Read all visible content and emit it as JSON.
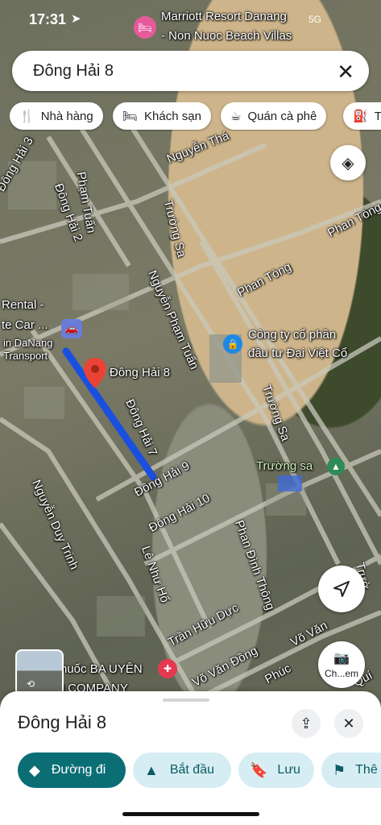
{
  "status_bar": {
    "time": "17:31",
    "network": "5G",
    "location_arrow": "location-arrow-icon"
  },
  "search": {
    "query": "Đông Hải 8",
    "clear_icon": "close-icon"
  },
  "chips": [
    {
      "icon": "fork-knife-icon",
      "label": "Nhà hàng"
    },
    {
      "icon": "bed-icon",
      "label": "Khách sạn"
    },
    {
      "icon": "coffee-icon",
      "label": "Quán cà phê"
    },
    {
      "icon": "fuel-icon",
      "label": "Tr"
    }
  ],
  "map": {
    "place_labels": {
      "marriott_1": "Marriott Resort Danang",
      "marriott_2": "- Non Nuoc Beach Villas",
      "company_1": "Công ty cổ phần",
      "company_2": "đầu tư Đại Việt Cổ",
      "rental_1": "Rental -",
      "rental_2": "te Car ...",
      "transport_1": "in DaNang",
      "transport_2": "Transport",
      "truong_sa_place": "Trường sa",
      "pharmacy": "huốc BA UYÊN",
      "kuwin": "KUWIN COMPANY"
    },
    "pin_label": "Đông Hải 8",
    "streets": {
      "nguyen_thai": "Nguyễn Thá",
      "pham_tuan": "Phạm Tuấn",
      "dong_hai_3": "Đông Hải 3",
      "dong_hai_2": "Đông Hải 2",
      "truong_sa_1": "Trường Sa",
      "truong_sa_2": "Trường Sa",
      "nguyen_pham_tuan": "Nguyễn Phạm Tuấn",
      "phan_tong_1": "Phan Tòng",
      "phan_tong_2": "Phan Tòng",
      "dong_hai_7": "Đông Hải 7",
      "dong_hai_9": "Đông Hải 9",
      "dong_hai_10": "Đông Hải 10",
      "nguyen_duy_trinh": "Nguyễn Duy Trinh",
      "le_nhu_ho": "Lê Như Hổ",
      "phan_dinh_thong": "Phan Đình Thông",
      "tran_huu_duc": "Trần Hữu Dực",
      "vo_van_dong": "Võ Văn Đồng",
      "vo_van_dong_2": "Võ Văn",
      "phuc": "Phúc",
      "truong_edge": "Trườ",
      "quy": "Quí"
    },
    "street_view_label": "Ch...em",
    "icons": [
      "layers-icon",
      "navigation-arrow-icon",
      "camera-icon",
      "map-pin-icon"
    ]
  },
  "sheet": {
    "title": "Đông Hải 8",
    "share_icon": "share-icon",
    "close_icon": "close-icon",
    "buttons": [
      {
        "icon": "directions-icon",
        "label": "Đường đi"
      },
      {
        "icon": "navigation-icon",
        "label": "Bắt đầu"
      },
      {
        "icon": "bookmark-icon",
        "label": "Lưu"
      },
      {
        "icon": "flag-icon",
        "label": "Thê"
      }
    ]
  },
  "colors": {
    "route": "#1a4fe0",
    "pin": "#ea4335",
    "primary": "#0b6e75",
    "secondary_bg": "#d6eef3"
  }
}
